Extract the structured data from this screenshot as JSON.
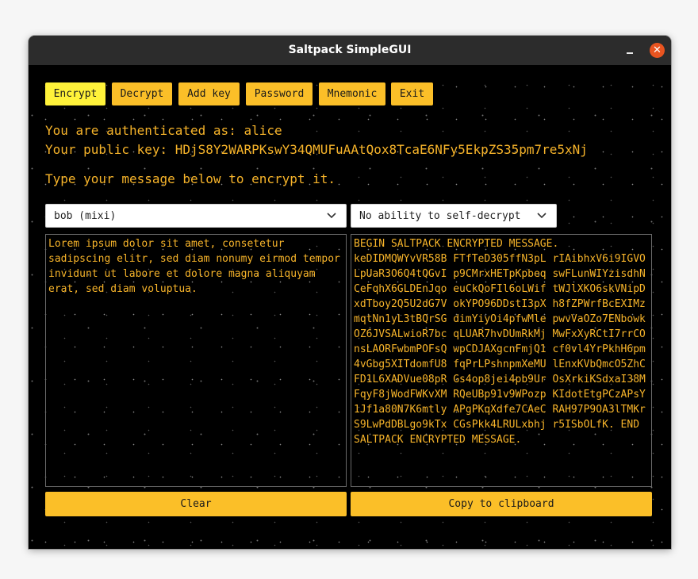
{
  "window": {
    "title": "Saltpack SimpleGUI",
    "minimize_glyph": "",
    "close_glyph": "✕"
  },
  "toolbar": {
    "buttons": [
      "Encrypt",
      "Decrypt",
      "Add key",
      "Password",
      "Mnemonic",
      "Exit"
    ],
    "active": "Encrypt"
  },
  "info": {
    "auth_line": "You are authenticated as: alice",
    "pubkey_line": "Your public key: HDjS8Y2WARPKswY34QMUFuAAtQox8TcaE6NFy5EkpZS35pm7re5xNj",
    "instruction": "Type your message below to encrypt it."
  },
  "recipient_select": {
    "value": "bob (mixi)",
    "icon": "chevron-down-icon"
  },
  "mode_select": {
    "value": "No ability to self-decrypt",
    "icon": "chevron-down-icon"
  },
  "input_text": "Lorem ipsum dolor sit amet, consetetur\nsadipscing elitr, sed diam nonumy eirmod tempor\ninvidunt ut labore et dolore magna aliquyam\nerat, sed diam voluptua.",
  "output_text": "BEGIN SALTPACK ENCRYPTED MESSAGE.\nkeDIDMQWYvVR58B FTfTeD305ffN3pL rIAibhxV6i9IGVO\nLpUaR3O6Q4tQGvI p9CMrxHETpKpbeq swFLunWIYzisdhN\nCeFqhX6GLDEnJqo euCkQoFIl6oLWif tWJlXKO6skVNipD\nxdTboy2Q5U2dG7V okYPO96DDstI3pX h8fZPWrfBcEXIMz\nmqtNn1yL3tBQrSG dimYiyOi4pfwMle pwvVaOZo7ENbowk\nOZ6JVSALwioR7bc qLUAR7hvDUmRkMj MwFxXyRCtI7rrCO\nnsLAORFwbmPOFsQ wpCDJAXgcnFmjQ1 cf0vl4YrPkhH6pm\n4vGbg5XITdomfU8 fqPrLPshnpmXeMU lEnxKVbQmcO5ZhC\nFD1L6XADVue08pR Gs4op8jei4pb9Ur OsXrkiKSdxaI38M\nFqyF8jWodFWKvXM RQeUBp91v9WPozp KIdotEtgPCzAPsY\n1Jf1a80N7K6mtly APgPKqXdfe7CAeC RAH97P9OA3lTMKr\nS9LwPdDBLgo9kTx CGsPkk4LRULxbhj r5ISbOLfK. END\nSALTPACK ENCRYPTED MESSAGE.",
  "actions": {
    "clear": "Clear",
    "copy": "Copy to clipboard"
  },
  "colors": {
    "accent": "#fbbf28",
    "active_button": "#fff23a",
    "text": "#f7b42a",
    "background": "#000000",
    "close": "#e95420"
  }
}
